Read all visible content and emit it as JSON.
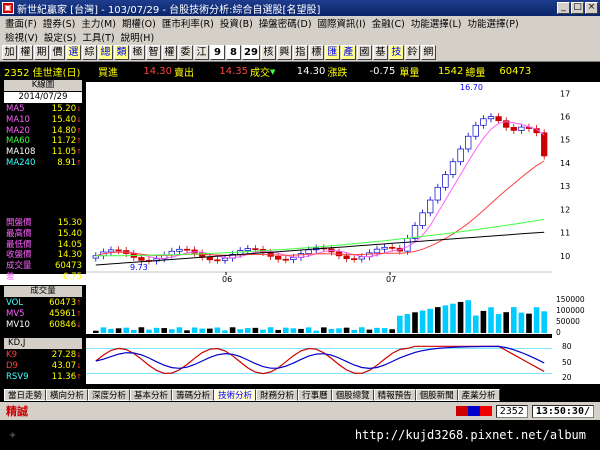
{
  "window": {
    "title": "新世紀贏家 [台灣] - 103/07/29 - 台股技術分析:綜合自選股[名望股]",
    "app_icon": "app-logo-icon"
  },
  "menu": {
    "row1": [
      "畫面(F)",
      "證券(S)",
      "主力(M)",
      "期權(O)",
      "匯市利率(R)",
      "投資(B)",
      "操盤密碼(D)",
      "國際資訊(I)",
      "金融(C)",
      "功能選擇(L)",
      "功能選擇(P)"
    ],
    "row2": [
      "檢視(V)",
      "設定(S)",
      "工具(T)",
      "說明(H)"
    ]
  },
  "toolbar": {
    "buttons": [
      "加",
      "權",
      "期",
      "價",
      "選",
      "綜",
      "總",
      "類",
      "極",
      "智",
      "權",
      "委",
      "江",
      "9",
      "8",
      "29",
      "核",
      "興",
      "指",
      "標",
      "匯",
      "產",
      "國",
      "基",
      "技",
      "鈴",
      "網"
    ],
    "highlighted": [
      "選",
      "總",
      "類",
      "匯",
      "產",
      "技"
    ],
    "numeric": [
      "9",
      "8",
      "29"
    ]
  },
  "quote": {
    "symbol": "2352 佳世達(日)",
    "buy_label": "買進",
    "buy": "14.30",
    "sell_label": "賣出",
    "sell": "14.35",
    "deal_label": "成交",
    "deal": "14.30",
    "change_label": "漲跌",
    "change": "-0.75",
    "vol_label": "單量",
    "vol": "1542",
    "total_label": "總量",
    "total": "60473"
  },
  "kpanel": {
    "title": "K線圖",
    "date": "2014/07/29",
    "ma": [
      {
        "name": "MA5",
        "value": "15.20",
        "color": "#ff60ff",
        "arrow": "↓"
      },
      {
        "name": "MA10",
        "value": "15.40",
        "color": "#ff60ff",
        "arrow": "↓"
      },
      {
        "name": "MA20",
        "value": "14.80",
        "color": "#ff60ff",
        "arrow": "↑"
      },
      {
        "name": "MA60",
        "value": "11.72",
        "color": "#40ff40",
        "arrow": "↑"
      },
      {
        "name": "MA108",
        "value": "11.05",
        "color": "#ffffff",
        "arrow": "↑"
      },
      {
        "name": "MA240",
        "value": "8.91",
        "color": "#40ffff",
        "arrow": "↑"
      }
    ],
    "prices": [
      {
        "name": "開盤價",
        "value": "15.30"
      },
      {
        "name": "最高價",
        "value": "15.40"
      },
      {
        "name": "最低價",
        "value": "14.05"
      },
      {
        "name": "收盤價",
        "value": "14.30"
      },
      {
        "name": "成交量",
        "value": "60473"
      },
      {
        "name": "差",
        "value": "-0.75"
      }
    ]
  },
  "volpanel": {
    "title": "成交量",
    "rows": [
      {
        "name": "VOL",
        "value": "60473",
        "color": "#40ffff",
        "arrow": "↑"
      },
      {
        "name": "MV5",
        "value": "45961",
        "color": "#ff60ff",
        "arrow": "↑"
      },
      {
        "name": "MV10",
        "value": "60846",
        "color": "#ffffff",
        "arrow": "↓"
      }
    ]
  },
  "kdpanel": {
    "title": "KD,J",
    "rows": [
      {
        "name": "K9",
        "value": "27.28",
        "color": "#ff4040",
        "arrow": "↓"
      },
      {
        "name": "D9",
        "value": "43.07",
        "color": "#ff4040",
        "arrow": "↓"
      },
      {
        "name": "RSV9",
        "value": "11.36",
        "color": "#40ffff",
        "arrow": "↑"
      }
    ]
  },
  "chart_data": [
    {
      "type": "candlestick",
      "title": "K線圖",
      "x_tick_labels": [
        "06",
        "07"
      ],
      "y_ticks": [
        10,
        11,
        12,
        13,
        14,
        15,
        16,
        17
      ],
      "ylim": [
        9.3,
        17.4
      ],
      "annotations": [
        "16.70",
        "9.73"
      ],
      "series": [
        {
          "name": "MA5",
          "color": "#ff60ff"
        },
        {
          "name": "MA20",
          "color": "#ff4040"
        },
        {
          "name": "MA60",
          "color": "#40ff40"
        },
        {
          "name": "MA108",
          "color": "#ffffff"
        }
      ]
    },
    {
      "type": "bar",
      "title": "成交量",
      "y_ticks": [
        "150000",
        "100000",
        "50000",
        "0"
      ],
      "ylim": [
        0,
        160000
      ]
    },
    {
      "type": "line",
      "title": "KD,J",
      "y_ticks": [
        "80",
        "50",
        "20"
      ],
      "ylim": [
        0,
        100
      ]
    }
  ],
  "tabs": [
    "當日走勢",
    "橫向分析",
    "深度分析",
    "基本分析",
    "籌碼分析",
    "技術分析",
    "財務分析",
    "行事曆",
    "個股總覽",
    "精報預告",
    "個股新聞",
    "產業分析"
  ],
  "active_tab": "技術分析",
  "status": {
    "label": "精誠",
    "symbol": "2352",
    "clock": "13:50:30/"
  },
  "footer": {
    "url": "http://kujd3268.pixnet.net/album"
  }
}
